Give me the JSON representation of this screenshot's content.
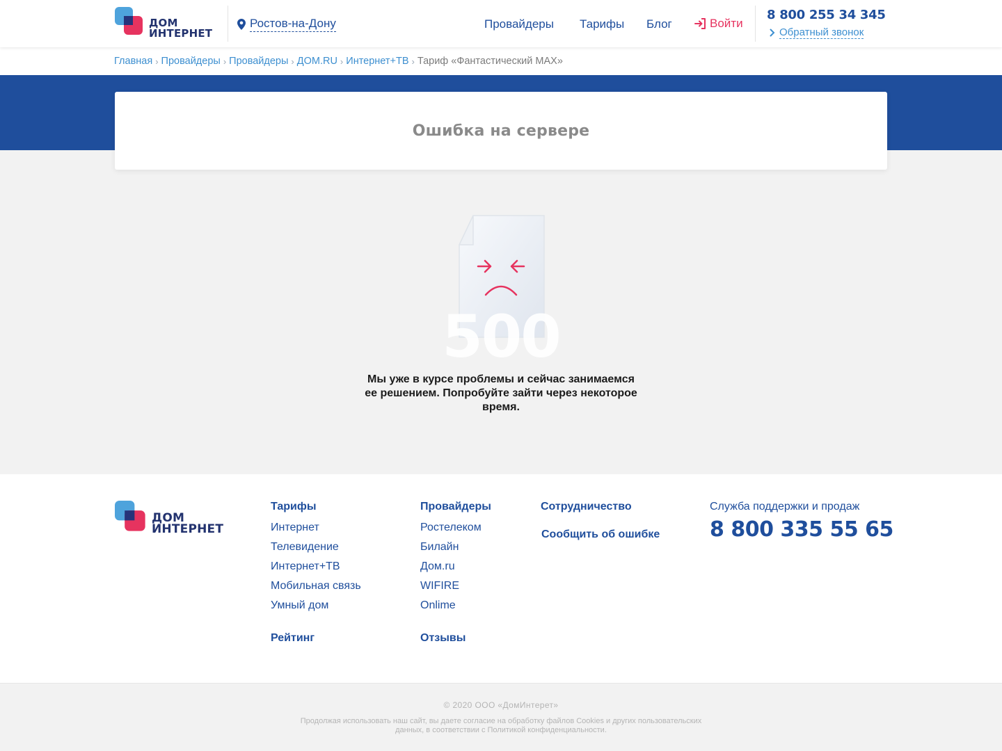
{
  "brand": {
    "line1": "ДОМ",
    "line2": "ИНТЕРНЕТ"
  },
  "header": {
    "city": "Ростов-на-Дону",
    "nav": [
      "Провайдеры",
      "Тарифы",
      "Блог"
    ],
    "login": "Войти",
    "phone": "8 800 255 34 345",
    "callback": "Обратный звонок"
  },
  "breadcrumbs": {
    "items": [
      "Главная",
      "Провайдеры",
      "Провайдеры",
      "ДОМ.RU",
      "Интернет+ТВ"
    ],
    "current": "Тариф «Фантастический MAX»"
  },
  "page": {
    "title": "Ошибка на сервере",
    "error_code": "500",
    "message": "Мы уже в курсе проблемы и сейчас занимаемся ее решением. Попробуйте зайти через некоторое время."
  },
  "footer": {
    "col_tariffs": {
      "title": "Тарифы",
      "links": [
        "Интернет",
        "Телевидение",
        "Интернет+ТВ",
        "Мобильная связь",
        "Умный дом"
      ],
      "extra": "Рейтинг"
    },
    "col_providers": {
      "title": "Провайдеры",
      "links": [
        "Ростелеком",
        "Билайн",
        "Дом.ru",
        "WIFIRE",
        "Onlime"
      ],
      "extra": "Отзывы"
    },
    "cooperation": "Сотрудничество",
    "report_error": "Сообщить об ошибке",
    "support_title": "Служба поддержки и продаж",
    "support_phone": "8 800 335 55 65"
  },
  "copyright": {
    "line": "© 2020 ООО «ДомИнтерет»",
    "cookies": "Продолжая использовать наш сайт, вы даете согласие на обработку файлов Cookies и других пользовательских данных, в соответствии с Политикой конфиденциальности."
  },
  "colors": {
    "brand_blue": "#1f4e9c",
    "accent_red": "#e6335f",
    "link_blue": "#3d8fd0"
  }
}
